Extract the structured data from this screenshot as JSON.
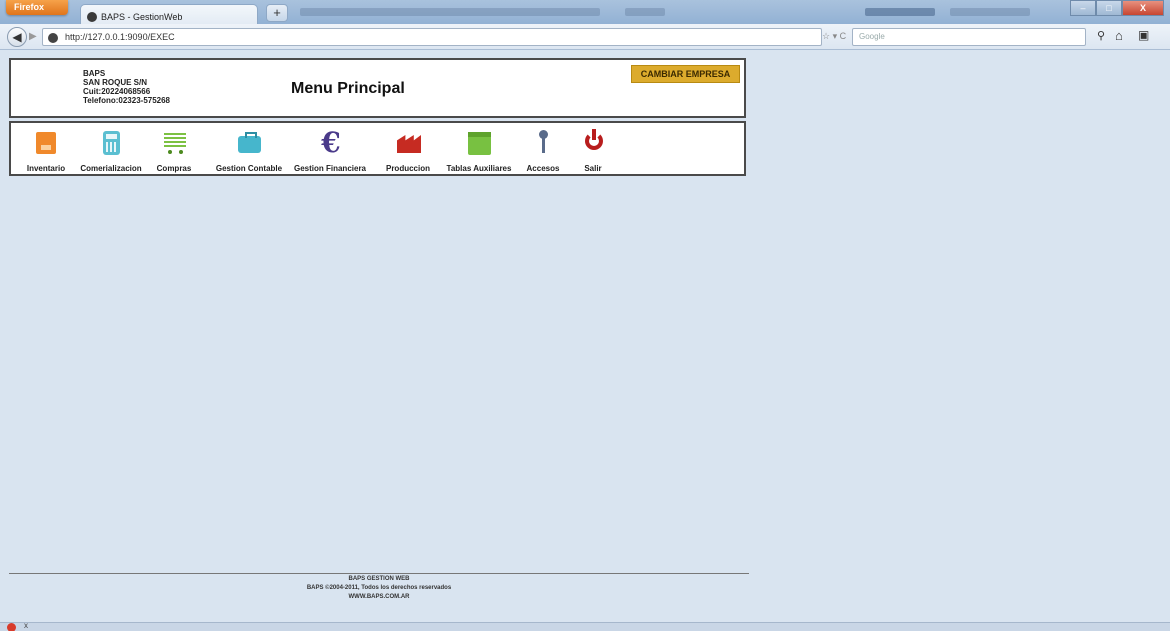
{
  "browser": {
    "app_button_label": "Firefox",
    "tab_title": "BAPS - GestionWeb",
    "new_tab_label": "+",
    "url": "http://127.0.0.1:9090/EXEC",
    "search_placeholder": "Google",
    "back_icon": "◀",
    "forward_icon": "▶",
    "url_controls": "☆ ▾ C",
    "search_icon": "⚲",
    "home_icon": "⌂",
    "bookmark_icon": "▣",
    "window_minimize": "–",
    "window_maximize": "□",
    "window_close": "X"
  },
  "company": {
    "name": "BAPS",
    "address": "SAN ROQUE S/N",
    "cuit": "Cuit:20224068566",
    "phone": "Telefono:02323-575268"
  },
  "header": {
    "title": "Menu Principal",
    "change_company_label": "CAMBIAR EMPRESA"
  },
  "menu": {
    "items": [
      {
        "label": "Inventario",
        "icon": "box-icon"
      },
      {
        "label": "Comerializacion",
        "icon": "calculator-icon"
      },
      {
        "label": "Compras",
        "icon": "cart-icon"
      },
      {
        "label": "Gestion Contable",
        "icon": "briefcase-icon"
      },
      {
        "label": "Gestion Financiera",
        "icon": "euro-icon"
      },
      {
        "label": "Produccion",
        "icon": "factory-icon"
      },
      {
        "label": "Tablas Auxiliares",
        "icon": "table-icon"
      },
      {
        "label": "Accesos",
        "icon": "key-icon"
      },
      {
        "label": "Salir",
        "icon": "power-icon"
      }
    ],
    "euro_symbol": "€"
  },
  "footer": {
    "line1": "BAPS GESTION WEB",
    "line2": "BAPS ©2004-2011, Todos los derechos reservados",
    "line3": "WWW.BAPS.COM.AR"
  },
  "statusbar": {
    "close_label": "x"
  },
  "colors": {
    "page_background": "#d9e4f0",
    "accent_button": "#dcab2d"
  }
}
